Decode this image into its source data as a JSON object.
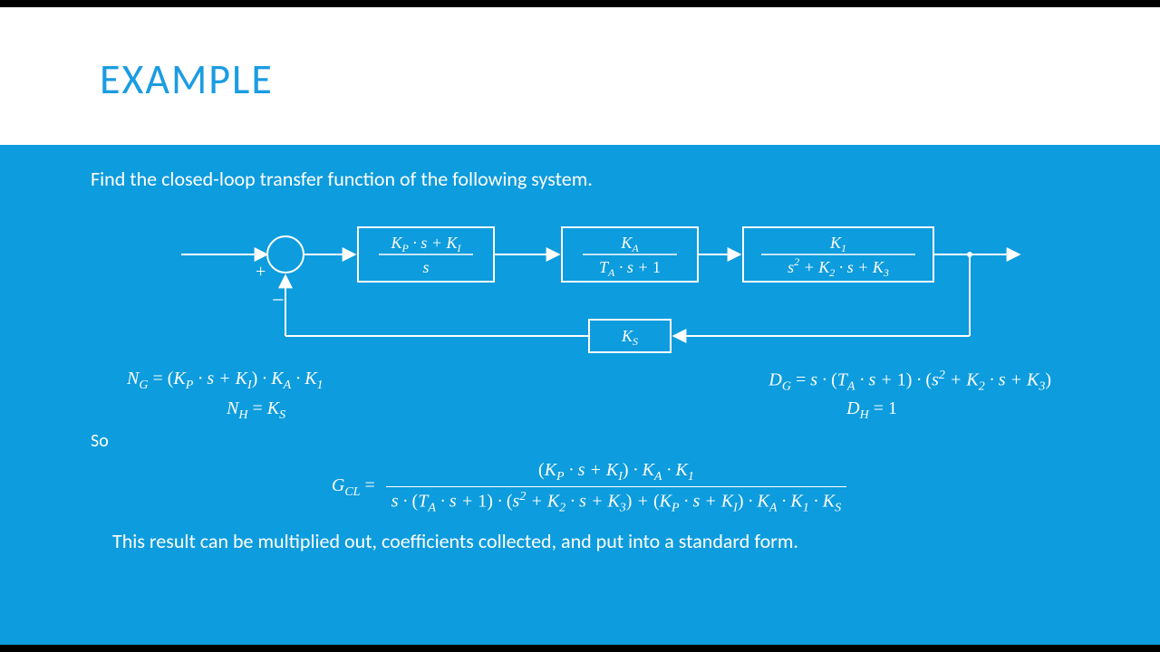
{
  "slide": {
    "title": "EXAMPLE",
    "prompt": "Find the closed-loop transfer function of the following system.",
    "note": "This result can be multiplied out, coefficients collected, and put into a standard form.",
    "so": "So"
  },
  "diagram": {
    "plus": "+",
    "minus": "−",
    "block1": {
      "num": "K_P · s + K_I",
      "den": "s"
    },
    "block2": {
      "num": "K_A",
      "den": "T_A · s + 1"
    },
    "block3": {
      "num": "K_1",
      "den": "s^2 + K_2 · s + K_3"
    },
    "feedback": "K_S"
  },
  "equations": {
    "NG": "N_G = (K_P · s + K_I) · K_A · K_1",
    "DG": "D_G = s · (T_A · s + 1) · (s^2 + K_2 · s + K_3)",
    "NH": "N_H = K_S",
    "DH": "D_H = 1",
    "GCL_label": "G_CL =",
    "GCL_num": "(K_P · s + K_I) · K_A · K_1",
    "GCL_den": "s · (T_A · s + 1) · (s^2 + K_2 · s + K_3) + (K_P · s + K_I) · K_A · K_1 · K_S"
  }
}
